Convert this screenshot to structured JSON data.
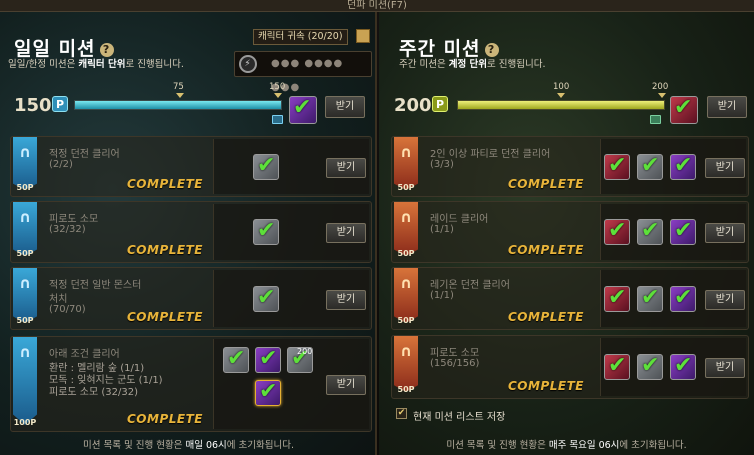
{
  "window": {
    "title": "던파 미션(F7)"
  },
  "daily": {
    "title": "일일 미션",
    "subtitle_pre": "일일/한정 미션은 ",
    "subtitle_bold": "캐릭터 단위",
    "subtitle_post": "로 진행됩니다.",
    "character_bind_label": "캐릭터 귀속 (20/20)",
    "character_id_masked": "●●● ●●●● ●●●",
    "points": "150",
    "point_badge": "P",
    "progress_fraction": 1.0,
    "ticks": [
      "75",
      "150"
    ],
    "claim_label": "받기",
    "footer_pre": "미션 목록 및 진행 현황은 ",
    "footer_bold": "매일 06시",
    "footer_post": "에 초기화됩니다.",
    "missions": [
      {
        "points": "50P",
        "name": "적정 던전 클리어",
        "progress": "(2/2)",
        "status": "COMPLETE",
        "claim": "받기",
        "rewards": [
          "grey"
        ]
      },
      {
        "points": "50P",
        "name": "피로도 소모",
        "progress": "(32/32)",
        "status": "COMPLETE",
        "claim": "받기",
        "rewards": [
          "grey"
        ]
      },
      {
        "points": "50P",
        "name": "적정 던전 일반 몬스터",
        "name2": "처치",
        "progress": "(70/70)",
        "status": "COMPLETE",
        "claim": "받기",
        "rewards": [
          "grey"
        ]
      },
      {
        "points": "100P",
        "name": "아래 조건 클리어",
        "line1": "환란 : 멜리람 숲 (1/1)",
        "line2": "모독 : 잊혀지는 군도 (1/1)",
        "line3": "피로도 소모 (32/32)",
        "status": "COMPLETE",
        "claim": "받기",
        "rewards": [
          "grey",
          "purple",
          "grey",
          "purple"
        ],
        "reward_count": "200"
      }
    ]
  },
  "weekly": {
    "title": "주간 미션",
    "subtitle_pre": "주간 미션은 ",
    "subtitle_bold": "계정 단위",
    "subtitle_post": "로 진행됩니다.",
    "points": "200",
    "point_badge": "P",
    "progress_fraction": 1.0,
    "ticks": [
      "100",
      "200"
    ],
    "claim_label": "받기",
    "save_checkbox_label": "현재 미션 리스트 저장",
    "footer_pre": "미션 목록 및 진행 현황은 ",
    "footer_bold": "매주 목요일 06시",
    "footer_post": "에 초기화됩니다.",
    "missions": [
      {
        "points": "50P",
        "name": "2인 이상 파티로 던전 클리어",
        "progress": "(3/3)",
        "status": "COMPLETE",
        "claim": "받기",
        "rewards": [
          "red",
          "grey",
          "purple"
        ]
      },
      {
        "points": "50P",
        "name": "레이드 클리어",
        "progress": "(1/1)",
        "status": "COMPLETE",
        "claim": "받기",
        "rewards": [
          "red",
          "grey",
          "purple"
        ]
      },
      {
        "points": "50P",
        "name": "레기온 던전 클리어",
        "progress": "(1/1)",
        "status": "COMPLETE",
        "claim": "받기",
        "rewards": [
          "red",
          "grey",
          "purple"
        ]
      },
      {
        "points": "50P",
        "name": "피로도 소모",
        "progress": "(156/156)",
        "status": "COMPLETE",
        "claim": "받기",
        "rewards": [
          "red",
          "grey",
          "purple"
        ]
      }
    ]
  },
  "colors": {
    "daily_bar": "#38c6d8",
    "weekly_bar": "#c6d83a",
    "complete": "#e8b43a",
    "check": "#5de03a"
  }
}
